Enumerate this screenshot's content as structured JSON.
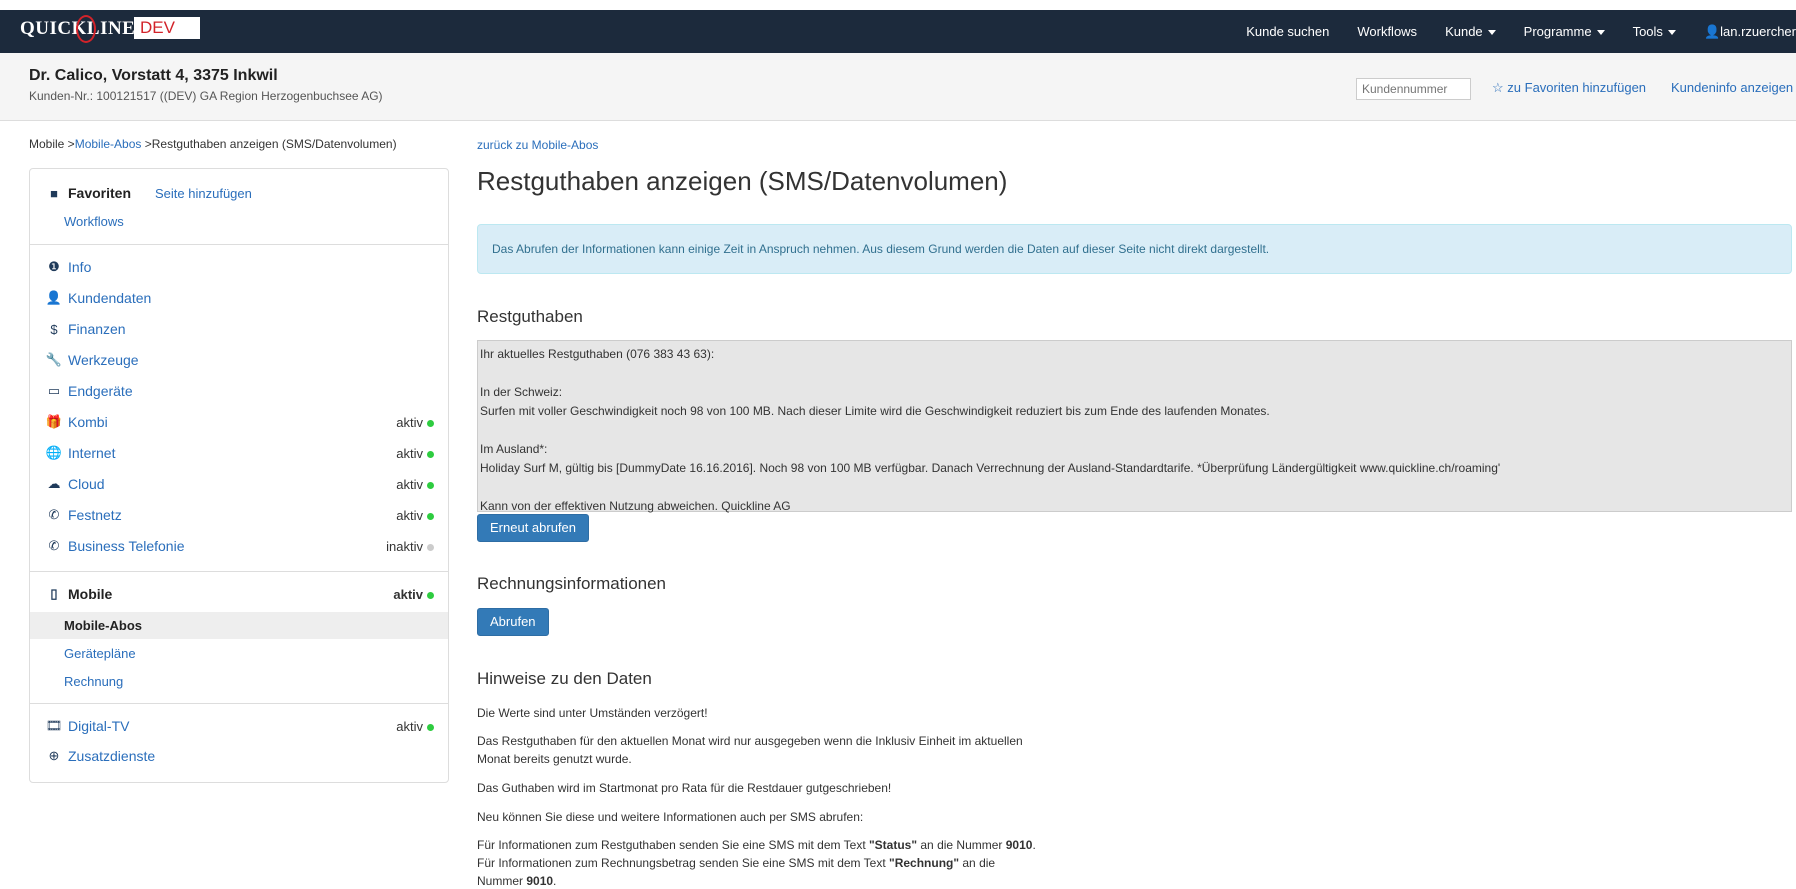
{
  "navbar": {
    "logo": "QUICKLINE",
    "env": "DEV",
    "items": [
      {
        "label": "Kunde suchen",
        "caret": false
      },
      {
        "label": "Workflows",
        "caret": false
      },
      {
        "label": "Kunde",
        "caret": true
      },
      {
        "label": "Programme",
        "caret": true
      },
      {
        "label": "Tools",
        "caret": true
      }
    ],
    "user": "lan.rzuercher"
  },
  "customer": {
    "name": "Dr. Calico, Vorstatt 4, 3375 Inkwil",
    "sub": "Kunden-Nr.: 100121517 ((DEV) GA Region Herzogenbuchsee AG)",
    "number_placeholder": "Kundennummer",
    "favorites_link": "zu Favoriten hinzufügen",
    "info_link": "Kundeninfo anzeigen"
  },
  "breadcrumb": {
    "root": "Mobile >",
    "link": "Mobile-Abos",
    "current": " >Restguthaben anzeigen (SMS/Datenvolumen)"
  },
  "sidebar": {
    "favorites_title": "Favoriten",
    "add_page": "Seite hinzufügen",
    "favorites_items": [
      "Workflows"
    ],
    "items": [
      {
        "label": "Info",
        "icon": "info-icon",
        "status": ""
      },
      {
        "label": "Kundendaten",
        "icon": "user-icon",
        "status": ""
      },
      {
        "label": "Finanzen",
        "icon": "dollar-icon",
        "status": ""
      },
      {
        "label": "Werkzeuge",
        "icon": "wrench-icon",
        "status": ""
      },
      {
        "label": "Endgeräte",
        "icon": "laptop-icon",
        "status": ""
      },
      {
        "label": "Kombi",
        "icon": "gift-icon",
        "status": "aktiv"
      },
      {
        "label": "Internet",
        "icon": "globe-icon",
        "status": "aktiv"
      },
      {
        "label": "Cloud",
        "icon": "cloud-icon",
        "status": "aktiv"
      },
      {
        "label": "Festnetz",
        "icon": "phone-icon",
        "status": "aktiv"
      },
      {
        "label": "Business Telefonie",
        "icon": "phone-icon",
        "status": "inaktiv"
      }
    ],
    "mobile": {
      "label": "Mobile",
      "status": "aktiv",
      "subitems": [
        "Mobile-Abos",
        "Gerätepläne",
        "Rechnung"
      ],
      "active": "Mobile-Abos"
    },
    "bottom_items": [
      {
        "label": "Digital-TV",
        "icon": "film-icon",
        "status": "aktiv"
      },
      {
        "label": "Zusatzdienste",
        "icon": "plus-circle-icon",
        "status": ""
      }
    ]
  },
  "main": {
    "back_link": "zurück zu Mobile-Abos",
    "title": "Restguthaben anzeigen (SMS/Datenvolumen)",
    "alert": "Das Abrufen der Informationen kann einige Zeit in Anspruch nehmen. Aus diesem Grund werden die Daten auf dieser Seite nicht direkt dargestellt.",
    "restguthaben_heading": "Restguthaben",
    "restguthaben_text": "Ihr aktuelles Restguthaben (076 383 43 63):\n\nIn der Schweiz:\nSurfen mit voller Geschwindigkeit noch 98 von 100 MB. Nach dieser Limite wird die Geschwindigkeit reduziert bis zum Ende des laufenden Monates.\n\nIm Ausland*:\nHoliday Surf M, gültig bis [DummyDate 16.16.2016]. Noch 98 von 100 MB verfügbar. Danach Verrechnung der Ausland-Standardtarife. *Überprüfung Ländergültigkeit www.quickline.ch/roaming'\n\nKann von der effektiven Nutzung abweichen. Quickline AG",
    "refresh_button": "Erneut abrufen",
    "rechnung_heading": "Rechnungsinformationen",
    "fetch_button": "Abrufen",
    "hints_heading": "Hinweise zu den Daten",
    "hints": [
      "Die Werte sind unter Umständen verzögert!",
      "Das Restguthaben für den aktuellen Monat wird nur ausgegeben wenn die Inklusiv Einheit im aktuellen Monat bereits genutzt wurde.",
      "Das Guthaben wird im Startmonat pro Rata für die Restdauer gutgeschrieben!",
      "Neu können Sie diese und weitere Informationen auch per SMS abrufen:"
    ],
    "sms_hint": {
      "p1": "Für Informationen zum Restguthaben senden Sie eine SMS mit dem Text ",
      "kw1": "\"Status\"",
      "p2": " an die Nummer ",
      "num1": "9010",
      "p3": ". Für Informationen zum Rechnungsbetrag senden Sie eine SMS mit dem Text ",
      "kw2": "\"Rechnung\"",
      "p4": " an die Nummer ",
      "num2": "9010",
      "p5": "."
    }
  }
}
